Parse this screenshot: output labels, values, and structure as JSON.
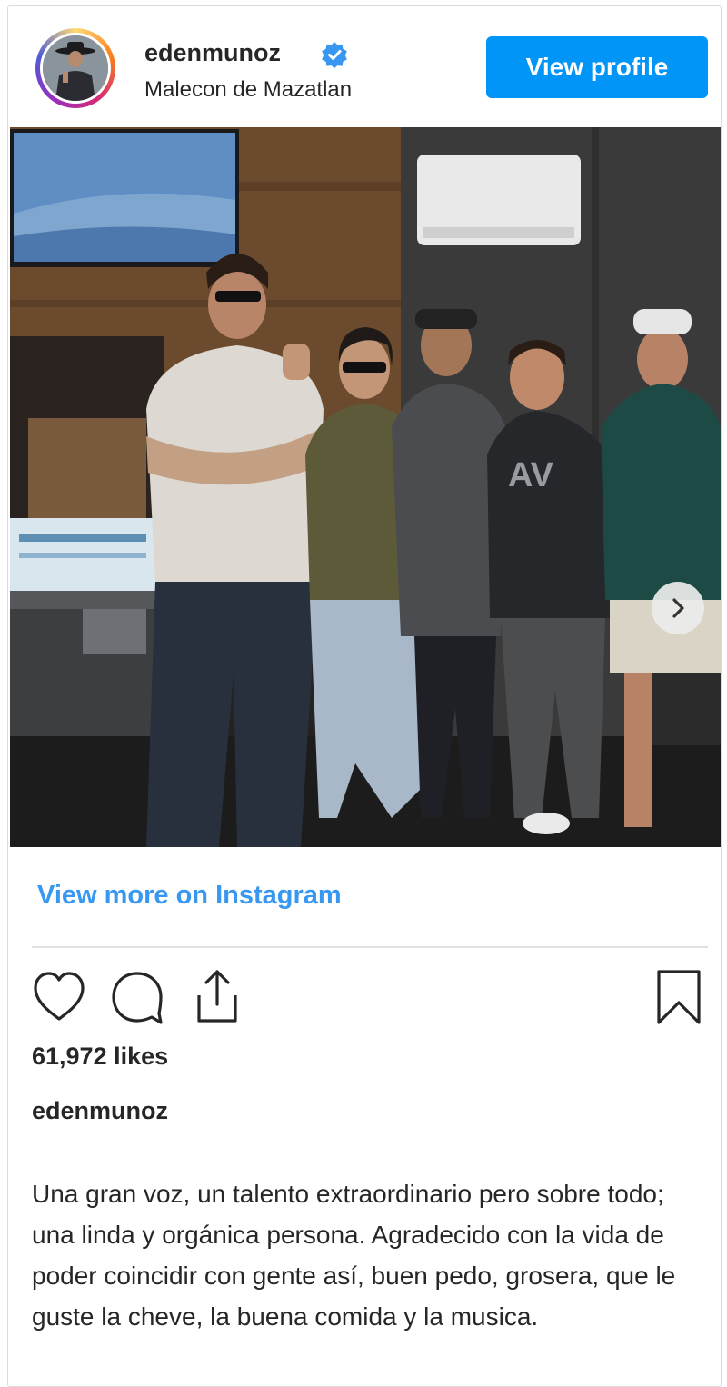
{
  "post": {
    "username": "edenmunoz",
    "location": "Malecon de Mazatlan",
    "view_profile_label": "View profile",
    "view_more_label": "View more on Instagram",
    "likes": "61,972 likes",
    "caption_user": "edenmunoz",
    "caption": "Una gran voz, un talento extraordinario pero sobre todo; una linda y orgánica persona. Agradecido con la vida de poder coincidir con gente así, buen pedo, grosera, que le guste la cheve, la buena comida y la musica.",
    "carousel": {
      "slides": 3,
      "active_slide": 1
    }
  },
  "icons": {
    "verified": "verified-badge-icon",
    "next": "chevron-right-icon",
    "like": "heart-icon",
    "comment": "comment-icon",
    "share": "share-icon",
    "save": "bookmark-icon"
  },
  "colors": {
    "accent": "#0095f6",
    "link": "#3897f0",
    "text": "#262626",
    "border": "#dbdbdb"
  }
}
